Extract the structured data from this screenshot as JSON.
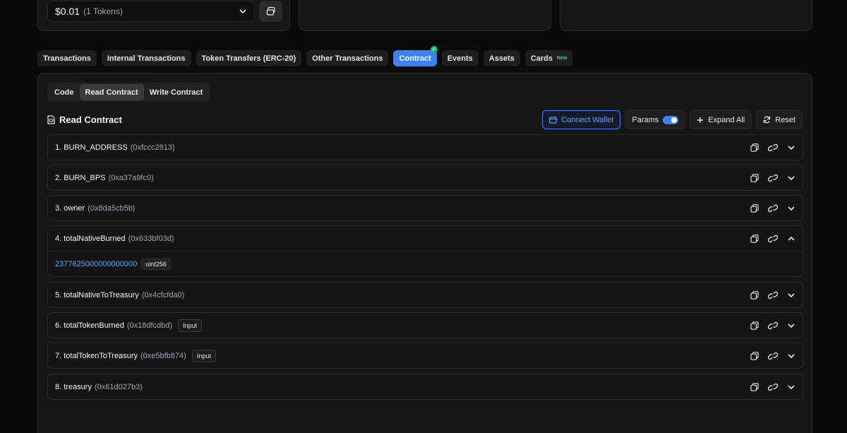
{
  "top_panel": {
    "value": "$0.01",
    "token_count": "(1 Tokens)"
  },
  "tabs": [
    {
      "label": "Transactions"
    },
    {
      "label": "Internal Transactions"
    },
    {
      "label": "Token Transfers (ERC-20)"
    },
    {
      "label": "Other Transactions"
    },
    {
      "label": "Contract"
    },
    {
      "label": "Events"
    },
    {
      "label": "Assets"
    },
    {
      "label": "Cards",
      "badge": "New"
    }
  ],
  "subtabs": [
    {
      "label": "Code"
    },
    {
      "label": "Read Contract"
    },
    {
      "label": "Write Contract"
    }
  ],
  "section_title": "Read Contract",
  "toolbar": {
    "connect_wallet": "Connect Wallet",
    "params": "Params",
    "expand_all": "Expand All",
    "reset": "Reset"
  },
  "functions": [
    {
      "name": "1. BURN_ADDRESS",
      "selector": "(0xfccc2813)"
    },
    {
      "name": "2. BURN_BPS",
      "selector": "(0xa37a9fc0)"
    },
    {
      "name": "3. owner",
      "selector": "(0x8da5cb5b)"
    },
    {
      "name": "4. totalNativeBurned",
      "selector": "(0x633bf03d)",
      "result": "2377625000000000000",
      "type": "uint256"
    },
    {
      "name": "5. totalNativeToTreasury",
      "selector": "(0x4cfcfda0)"
    },
    {
      "name": "6. totalTokenBurned",
      "selector": "(0x18dfcdbd)",
      "badge": "Input"
    },
    {
      "name": "7. totalTokenToTreasury",
      "selector": "(0xe5bfb874)",
      "badge": "Input"
    },
    {
      "name": "8. treasury",
      "selector": "(0x61d027b3)"
    }
  ],
  "colors": {
    "accent": "#3b82f6",
    "background": "#0a0a0a",
    "panel": "#161616",
    "success": "#10b981"
  }
}
